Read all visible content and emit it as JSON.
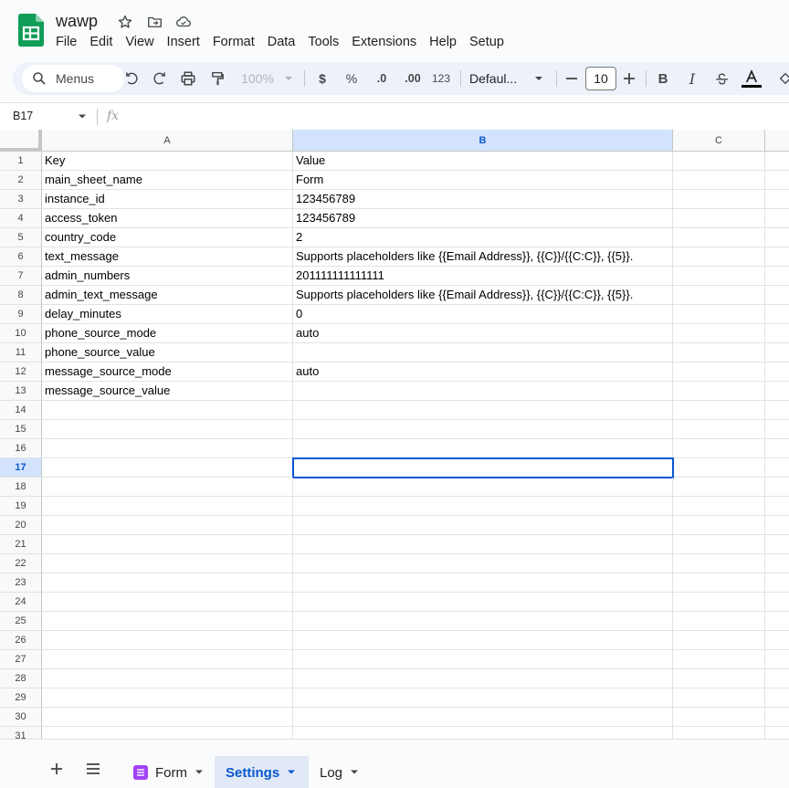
{
  "app": {
    "doc_title": "wawp",
    "menu": [
      "File",
      "Edit",
      "View",
      "Insert",
      "Format",
      "Data",
      "Tools",
      "Extensions",
      "Help",
      "Setup"
    ]
  },
  "toolbar": {
    "menus_label": "Menus",
    "zoom": "100%",
    "currency": "$",
    "percent": "%",
    "decimal_decrease": ".0",
    "decimal_increase": ".00",
    "number_format": "123",
    "font": "Defaul...",
    "font_size": "10",
    "bold": "B",
    "italic": "I"
  },
  "formula_bar": {
    "cell_ref": "B17",
    "fx_label": "fx"
  },
  "sheet": {
    "columns": [
      "A",
      "B",
      "C"
    ],
    "selected_column": "B",
    "selected_row": "17",
    "rows": [
      {
        "num": "1",
        "a": "Key",
        "b": "Value"
      },
      {
        "num": "2",
        "a": "main_sheet_name",
        "b": "Form"
      },
      {
        "num": "3",
        "a": "instance_id",
        "b": "123456789"
      },
      {
        "num": "4",
        "a": "access_token",
        "b": "123456789"
      },
      {
        "num": "5",
        "a": "country_code",
        "b": "2"
      },
      {
        "num": "6",
        "a": "text_message",
        "b": "Supports placeholders like {{Email Address}}, {{C}}/{{C:C}}, {{5}}."
      },
      {
        "num": "7",
        "a": "admin_numbers",
        "b": "201111111111111"
      },
      {
        "num": "8",
        "a": "admin_text_message",
        "b": "Supports placeholders like {{Email Address}}, {{C}}/{{C:C}}, {{5}}."
      },
      {
        "num": "9",
        "a": "delay_minutes",
        "b": "0"
      },
      {
        "num": "10",
        "a": "phone_source_mode",
        "b": "auto"
      },
      {
        "num": "11",
        "a": "phone_source_value",
        "b": ""
      },
      {
        "num": "12",
        "a": "message_source_mode",
        "b": "auto"
      },
      {
        "num": "13",
        "a": "message_source_value",
        "b": ""
      },
      {
        "num": "14",
        "a": "",
        "b": ""
      },
      {
        "num": "15",
        "a": "",
        "b": ""
      },
      {
        "num": "16",
        "a": "",
        "b": ""
      },
      {
        "num": "17",
        "a": "",
        "b": ""
      },
      {
        "num": "18",
        "a": "",
        "b": ""
      },
      {
        "num": "19",
        "a": "",
        "b": ""
      },
      {
        "num": "20",
        "a": "",
        "b": ""
      },
      {
        "num": "21",
        "a": "",
        "b": ""
      },
      {
        "num": "22",
        "a": "",
        "b": ""
      },
      {
        "num": "23",
        "a": "",
        "b": ""
      },
      {
        "num": "24",
        "a": "",
        "b": ""
      },
      {
        "num": "25",
        "a": "",
        "b": ""
      },
      {
        "num": "26",
        "a": "",
        "b": ""
      },
      {
        "num": "27",
        "a": "",
        "b": ""
      },
      {
        "num": "28",
        "a": "",
        "b": ""
      },
      {
        "num": "29",
        "a": "",
        "b": ""
      },
      {
        "num": "30",
        "a": "",
        "b": ""
      },
      {
        "num": "31",
        "a": "",
        "b": ""
      }
    ]
  },
  "tabs": [
    {
      "label": "Form",
      "active": false
    },
    {
      "label": "Settings",
      "active": true
    },
    {
      "label": "Log",
      "active": false
    }
  ],
  "colors": {
    "accent": "#0b57d0",
    "selection_fill": "#d3e3fd",
    "sheets_green": "#0f9d58",
    "form_tab_icon": "#a142f4"
  }
}
